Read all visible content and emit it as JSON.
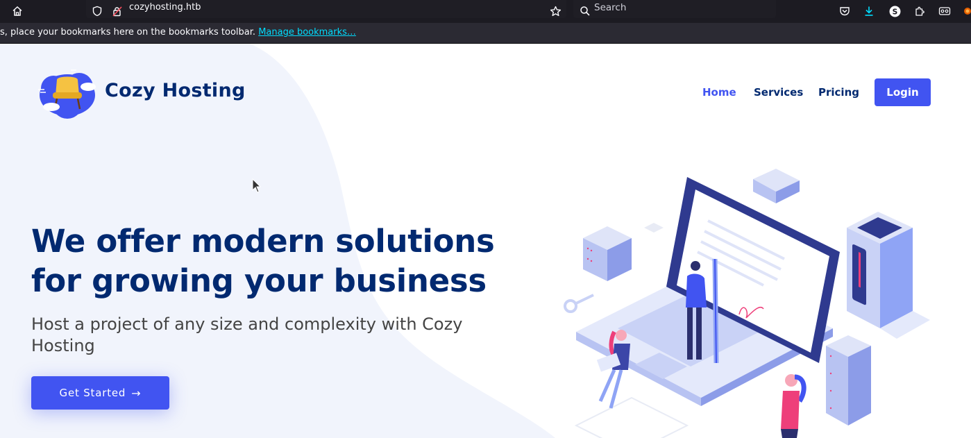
{
  "browser": {
    "url": "cozyhosting.htb",
    "search_placeholder": "Search",
    "bookmarks_text": "s, place your bookmarks here on the bookmarks toolbar.",
    "bookmarks_link": "Manage bookmarks…"
  },
  "site": {
    "brand": "Cozy Hosting",
    "nav": {
      "home": "Home",
      "services": "Services",
      "pricing": "Pricing",
      "login": "Login"
    },
    "hero": {
      "headline_line1": "We offer modern solutions",
      "headline_line2": "for growing your business",
      "subheadline": "Host a project of any size and complexity with Cozy Hosting",
      "cta": "Get Started"
    }
  },
  "colors": {
    "accent": "#4154f1",
    "heading": "#012970",
    "text": "#444444"
  }
}
